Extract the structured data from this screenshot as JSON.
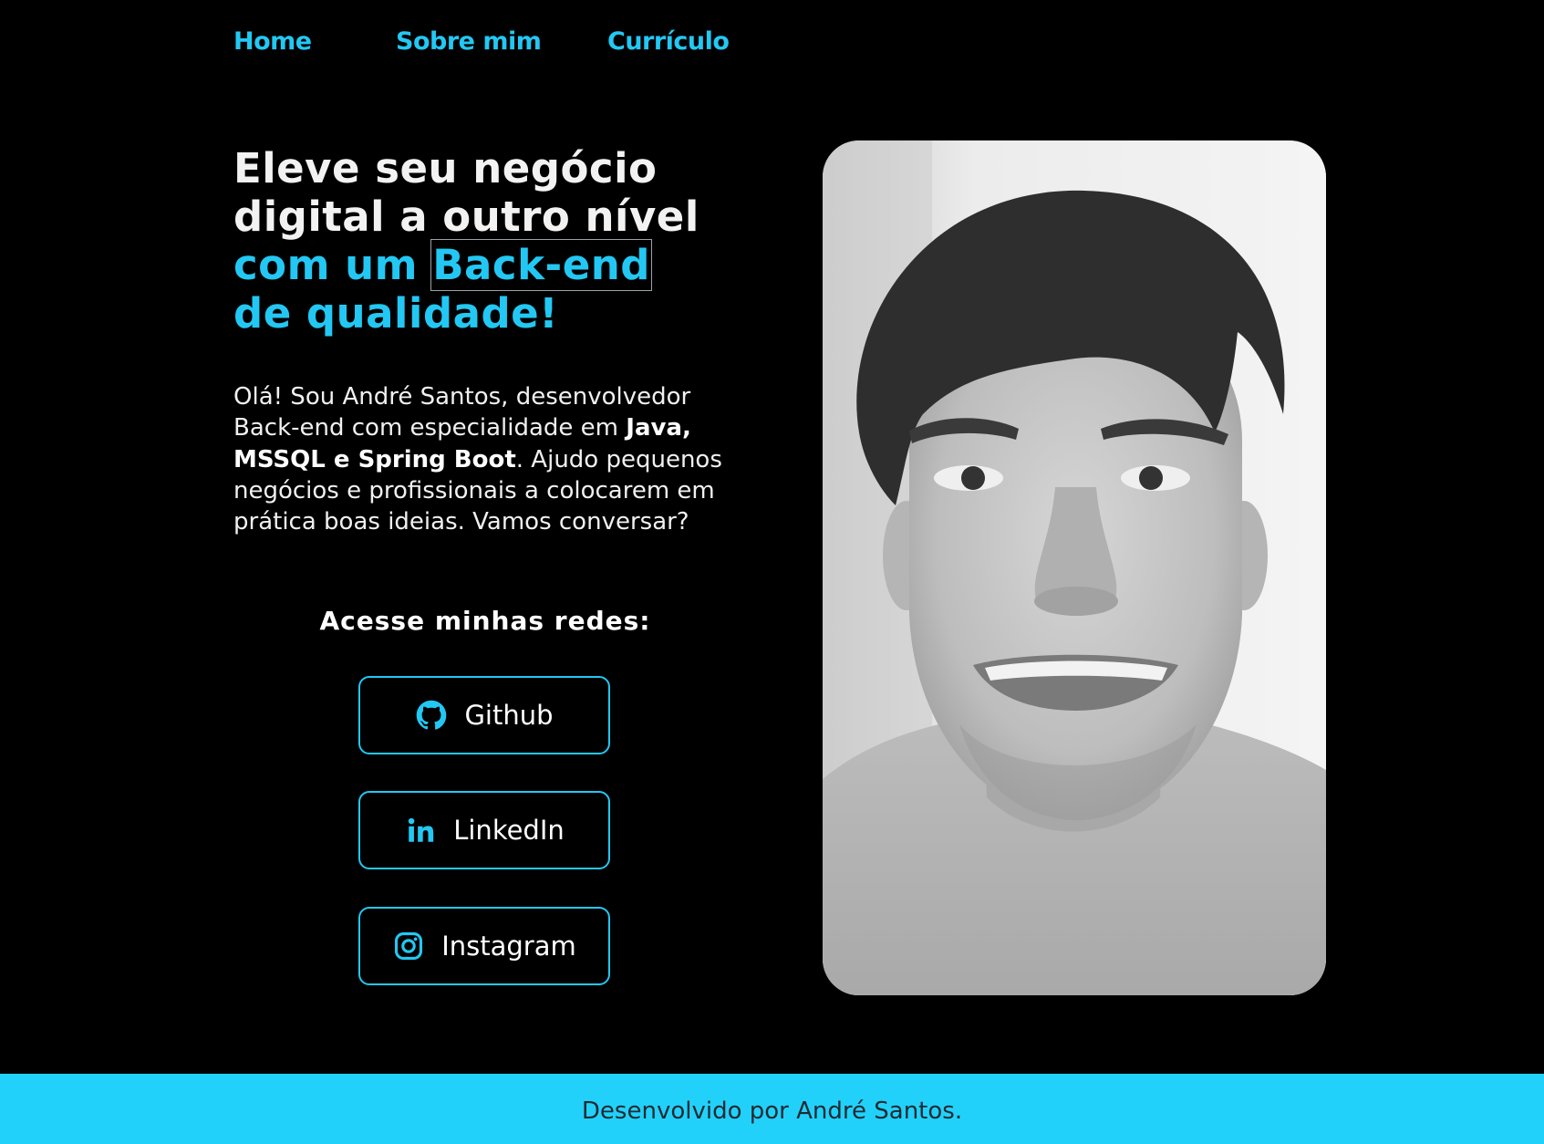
{
  "nav": {
    "home": "Home",
    "about": "Sobre mim",
    "resume": "Currículo"
  },
  "hero": {
    "line1": "Eleve seu negócio",
    "line2": "digital a outro nível",
    "line3_a": "com um ",
    "line3_b": "Back-end",
    "line4": "de qualidade!",
    "intro_1": "Olá! Sou André Santos, desenvolvedor Back-end com especialidade em ",
    "intro_bold": "Java, MSSQL e Spring Boot",
    "intro_2": ". Ajudo pequenos negócios e profissionais a colocarem em prática boas ideias. Vamos conversar?"
  },
  "social": {
    "title": "Acesse minhas redes:",
    "github": "Github",
    "linkedin": "LinkedIn",
    "instagram": "Instagram",
    "github_icon": "github-icon",
    "linkedin_icon": "linkedin-icon",
    "instagram_icon": "instagram-icon"
  },
  "footer": {
    "text": "Desenvolvido por André Santos."
  },
  "colors": {
    "accent": "#22c8f3",
    "background": "#000000",
    "footer_bg": "#22d1fa"
  }
}
